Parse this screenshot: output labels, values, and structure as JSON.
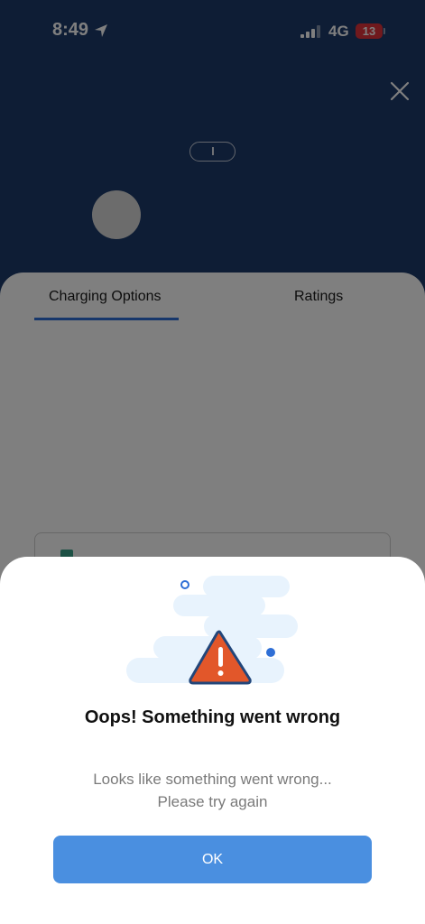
{
  "status_bar": {
    "time": "8:49",
    "network": "4G",
    "battery": "13"
  },
  "tabs": [
    {
      "label": "Charging Options",
      "active": true
    },
    {
      "label": "Ratings",
      "active": false
    }
  ],
  "dialog": {
    "title": "Oops! Something went wrong",
    "message_line1": "Looks like something went wrong...",
    "message_line2": "Please try again",
    "ok_label": "OK",
    "icon": "warning-triangle-icon"
  },
  "colors": {
    "header_bg": "#1c3a6b",
    "accent": "#2f6fd6",
    "ok_button": "#4a8fe0",
    "warning": "#e2572a"
  }
}
